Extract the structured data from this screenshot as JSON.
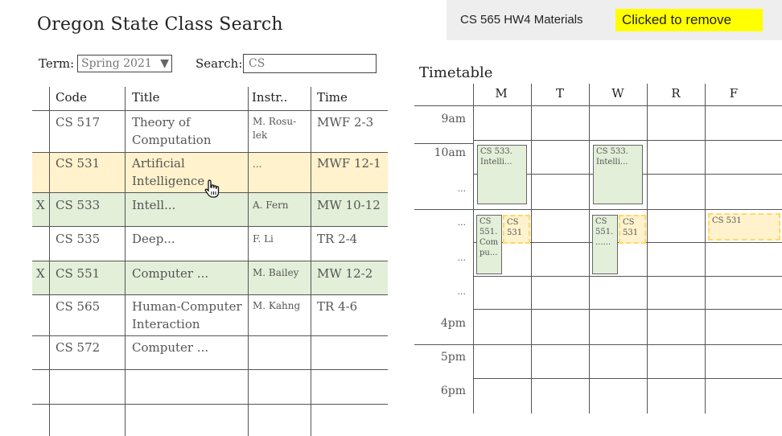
{
  "app": {
    "title": "Oregon State Class Search"
  },
  "filters": {
    "term_label": "Term:",
    "term_value": "Spring 2021",
    "search_label": "Search:",
    "search_value": "CS"
  },
  "table": {
    "headers": [
      "Code",
      "Title",
      "Instr..",
      "Time"
    ],
    "rows": [
      {
        "mark": "",
        "code": "CS 517",
        "title": [
          "Theory of",
          "Computation"
        ],
        "instr": [
          "M. Rosu-",
          "lek"
        ],
        "time": "MWF 2-3",
        "highlight": ""
      },
      {
        "mark": "",
        "code": "CS 531",
        "title": [
          "Artificial",
          "Intelligence"
        ],
        "instr": [
          "..."
        ],
        "time": "MWF 12-1",
        "highlight": "yellow"
      },
      {
        "mark": "X",
        "code": "CS 533",
        "title": [
          "Intell..."
        ],
        "instr": [
          "A. Fern"
        ],
        "time": "MW 10-12",
        "highlight": "green"
      },
      {
        "mark": "",
        "code": "CS 535",
        "title": [
          "Deep..."
        ],
        "instr": [
          "F. Li"
        ],
        "time": "TR 2-4",
        "highlight": ""
      },
      {
        "mark": "X",
        "code": "CS 551",
        "title": [
          "Computer ..."
        ],
        "instr": [
          "M. Bailey"
        ],
        "time": "MW 12-2",
        "highlight": "green"
      },
      {
        "mark": "",
        "code": "CS 565",
        "title": [
          "Human-Computer",
          "Interaction"
        ],
        "instr": [
          "M. Kahng"
        ],
        "time": "TR 4-6",
        "highlight": ""
      },
      {
        "mark": "",
        "code": "CS 572",
        "title": [
          "Computer ..."
        ],
        "instr": [],
        "time": "",
        "highlight": ""
      }
    ]
  },
  "notification": {
    "materials": "CS 565 HW4 Materials",
    "remove_label": "Clicked to remove",
    "badge_color": "#ffff00"
  },
  "timetable": {
    "title": "Timetable",
    "days": [
      "M",
      "T",
      "W",
      "R",
      "F"
    ],
    "time_labels": [
      "9am",
      "10am",
      "...",
      "...",
      "...",
      "...",
      "4pm",
      "5pm",
      "6pm"
    ],
    "blocks": [
      {
        "day": "M",
        "style": "green",
        "lines": [
          "CS 533.",
          "Intelli..."
        ]
      },
      {
        "day": "W",
        "style": "green",
        "lines": [
          "CS 533.",
          "Intelli..."
        ]
      },
      {
        "day": "M",
        "style": "green",
        "lines": [
          "CS",
          "551.",
          "Com",
          "pu..."
        ]
      },
      {
        "day": "M",
        "style": "dashed",
        "lines": [
          "CS",
          "531"
        ]
      },
      {
        "day": "W",
        "style": "green",
        "lines": [
          "CS",
          "551.",
          "......"
        ]
      },
      {
        "day": "W",
        "style": "dashed",
        "lines": [
          "CS",
          "531"
        ]
      },
      {
        "day": "F",
        "style": "dashed",
        "lines": [
          "CS 531"
        ]
      }
    ]
  },
  "colors": {
    "highlight_yellow": "#fff2cc",
    "highlight_green": "#e3efd9",
    "dashed_border": "#ffd966"
  }
}
